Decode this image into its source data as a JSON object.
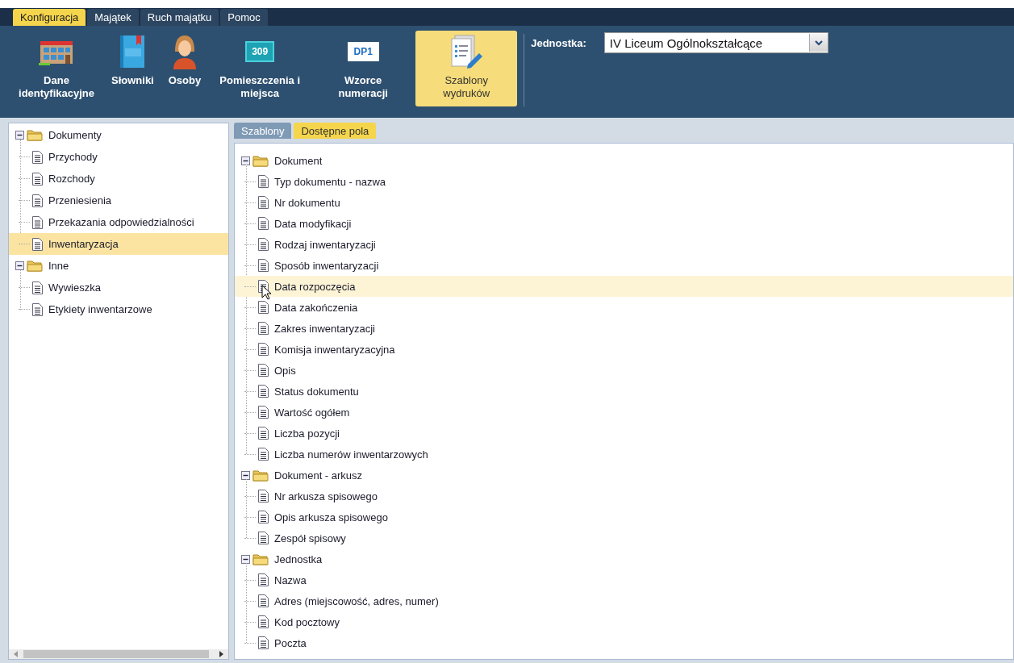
{
  "menu_tabs": [
    {
      "label": "Konfiguracja",
      "selected": true
    },
    {
      "label": "Majątek",
      "selected": false
    },
    {
      "label": "Ruch majątku",
      "selected": false
    },
    {
      "label": "Pomoc",
      "selected": false
    }
  ],
  "toolbar": {
    "buttons": [
      {
        "kind": "building",
        "label": "Dane identyfikacyjne",
        "selected": false
      },
      {
        "kind": "dictionary",
        "label": "Słowniki",
        "selected": false
      },
      {
        "kind": "person",
        "label": "Osoby",
        "selected": false
      },
      {
        "kind": "room",
        "label": "Pomieszczenia i miejsca",
        "icon_text": "309",
        "selected": false
      },
      {
        "kind": "numbering",
        "label": "Wzorce numeracji",
        "icon_text": "DP1",
        "selected": false
      },
      {
        "kind": "template",
        "label": "Szablony wydruków",
        "selected": true
      }
    ],
    "unit_label": "Jednostka:",
    "unit_value": "IV Liceum Ogólnokształcące"
  },
  "left_tree": [
    {
      "label": "Dokumenty",
      "expanded": true,
      "selected": false,
      "children": [
        {
          "label": "Przychody",
          "selected": false
        },
        {
          "label": "Rozchody",
          "selected": false
        },
        {
          "label": "Przeniesienia",
          "selected": false
        },
        {
          "label": "Przekazania odpowiedzialności",
          "selected": false
        },
        {
          "label": "Inwentaryzacja",
          "selected": true
        }
      ]
    },
    {
      "label": "Inne",
      "expanded": true,
      "selected": false,
      "children": [
        {
          "label": "Wywieszka",
          "selected": false
        },
        {
          "label": "Etykiety inwentarzowe",
          "selected": false
        }
      ]
    }
  ],
  "content_tabs": [
    {
      "label": "Szablony",
      "selected": false
    },
    {
      "label": "Dostępne pola",
      "selected": true
    }
  ],
  "fields_tree": [
    {
      "label": "Dokument",
      "expanded": true,
      "children": [
        {
          "label": "Typ dokumentu - nazwa",
          "highlighted": false
        },
        {
          "label": "Nr dokumentu",
          "highlighted": false
        },
        {
          "label": "Data modyfikacji",
          "highlighted": false
        },
        {
          "label": "Rodzaj inwentaryzacji",
          "highlighted": false
        },
        {
          "label": "Sposób inwentaryzacji",
          "highlighted": false
        },
        {
          "label": "Data rozpoczęcia",
          "highlighted": true
        },
        {
          "label": "Data zakończenia",
          "highlighted": false
        },
        {
          "label": "Zakres inwentaryzacji",
          "highlighted": false
        },
        {
          "label": "Komisja inwentaryzacyjna",
          "highlighted": false
        },
        {
          "label": "Opis",
          "highlighted": false
        },
        {
          "label": "Status dokumentu",
          "highlighted": false
        },
        {
          "label": "Wartość ogółem",
          "highlighted": false
        },
        {
          "label": "Liczba pozycji",
          "highlighted": false
        },
        {
          "label": "Liczba numerów inwentarzowych",
          "highlighted": false
        }
      ]
    },
    {
      "label": "Dokument - arkusz",
      "expanded": true,
      "children": [
        {
          "label": "Nr arkusza spisowego",
          "highlighted": false
        },
        {
          "label": "Opis arkusza spisowego",
          "highlighted": false
        },
        {
          "label": "Zespół spisowy",
          "highlighted": false
        }
      ]
    },
    {
      "label": "Jednostka",
      "expanded": true,
      "children": [
        {
          "label": "Nazwa",
          "highlighted": false
        },
        {
          "label": "Adres (miejscowość, adres, numer)",
          "highlighted": false
        },
        {
          "label": "Kod pocztowy",
          "highlighted": false
        },
        {
          "label": "Poczta",
          "highlighted": false
        }
      ]
    }
  ]
}
